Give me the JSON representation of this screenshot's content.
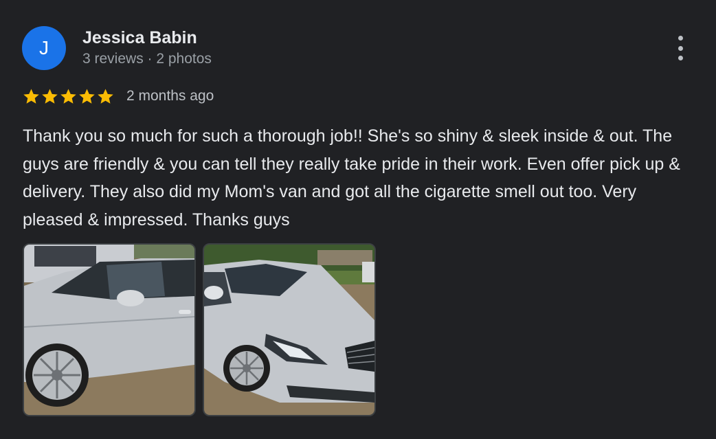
{
  "reviewer": {
    "initial": "J",
    "name": "Jessica Babin",
    "meta": "3 reviews · 2 photos",
    "avatar_color": "#1a73e8"
  },
  "rating": {
    "stars": 5,
    "max": 5,
    "star_color": "#fbbc04",
    "time": "2 months ago"
  },
  "review_text": "Thank you so much for such a thorough job!! She's so shiny & sleek inside & out. The guys are friendly & you can tell they really take pride in their work. Even offer pick up & delivery. They also did my Mom's van and got all the cigarette smell out too. Very pleased & impressed. Thanks guys",
  "menu": {
    "icon": "more-vert-icon"
  },
  "photos": [
    {
      "name": "review-photo-1",
      "subject": "silver sedan side view"
    },
    {
      "name": "review-photo-2",
      "subject": "silver sedan front view"
    }
  ],
  "colors": {
    "background": "#202124",
    "primary_text": "#e8eaed",
    "secondary_text": "#9aa0a6"
  }
}
